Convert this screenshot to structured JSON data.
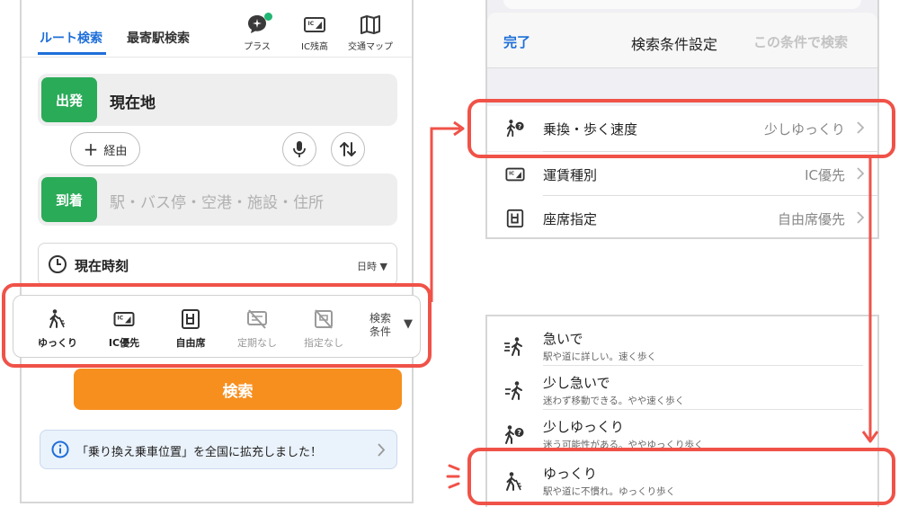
{
  "left": {
    "tabs": [
      "ルート検索",
      "最寄駅検索"
    ],
    "header_icons": [
      {
        "label": "プラス",
        "icon": "plus-chat-icon"
      },
      {
        "label": "IC残高",
        "icon": "ic-card-icon"
      },
      {
        "label": "交通マップ",
        "icon": "map-icon"
      }
    ],
    "departure": {
      "tag": "出発",
      "value": "現在地"
    },
    "via_button": "経由",
    "arrival": {
      "tag": "到着",
      "placeholder": "駅・バス停・空港・施設・住所"
    },
    "time": {
      "label": "現在時刻",
      "mode": "日時"
    },
    "conditions": [
      {
        "label": "ゆっくり",
        "icon": "slow-walker-icon",
        "active": true
      },
      {
        "label": "IC優先",
        "icon": "ic-card-icon",
        "active": true
      },
      {
        "label": "自由席",
        "icon": "seat-icon",
        "active": true
      },
      {
        "label": "定期なし",
        "icon": "pass-off-icon",
        "active": false
      },
      {
        "label": "指定なし",
        "icon": "reserved-off-icon",
        "active": false
      }
    ],
    "conditions_more": [
      "検索",
      "条件"
    ],
    "search_button": "検索",
    "notice": "「乗り換え乗車位置」を全国に拡充しました！"
  },
  "settings": {
    "done": "完了",
    "title": "検索条件設定",
    "action": "この条件で検索",
    "rows": [
      {
        "label": "乗換・歩く速度",
        "value": "少しゆっくり",
        "icon": "walker-question-icon"
      },
      {
        "label": "運賃種別",
        "value": "IC優先",
        "icon": "ic-card-icon"
      },
      {
        "label": "座席指定",
        "value": "自由席優先",
        "icon": "seat-icon"
      }
    ]
  },
  "speed_options": [
    {
      "title": "急いで",
      "subtitle": "駅や道に詳しい。速く歩く",
      "icon": "fast-walker-icon"
    },
    {
      "title": "少し急いで",
      "subtitle": "迷わず移動できる。やや速く歩く",
      "icon": "brisk-walker-icon"
    },
    {
      "title": "少しゆっくり",
      "subtitle": "迷う可能性がある。ややゆっくり歩く",
      "icon": "walker-question-icon"
    },
    {
      "title": "ゆっくり",
      "subtitle": "駅や道に不慣れ。ゆっくり歩く",
      "icon": "slow-walker-icon"
    }
  ],
  "colors": {
    "accent_blue": "#1e6fd9",
    "green": "#2aab58",
    "orange": "#f78f1f",
    "highlight": "#f05248"
  }
}
